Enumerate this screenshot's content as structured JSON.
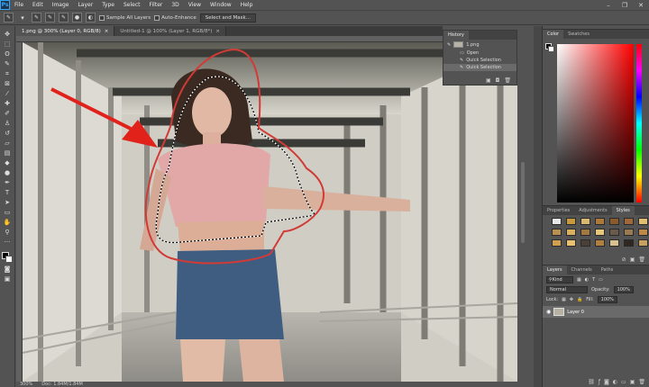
{
  "app": {
    "logo": "Ps"
  },
  "menu": [
    "File",
    "Edit",
    "Image",
    "Layer",
    "Type",
    "Select",
    "Filter",
    "3D",
    "View",
    "Window",
    "Help"
  ],
  "window_controls": [
    "–",
    "❐",
    "✕"
  ],
  "options": {
    "sample_all_layers": "Sample All Layers",
    "auto_enhance": "Auto-Enhance",
    "select_mask": "Select and Mask..."
  },
  "tabs": [
    {
      "label": "1.png @ 300% (Layer 0, RGB/8)",
      "close": "×"
    },
    {
      "label": "Untitled-1 @ 100% (Layer 1, RGB/8*)",
      "close": "×"
    }
  ],
  "status": {
    "zoom": "300%",
    "doc": "Doc: 1.84M/1.84M"
  },
  "history": {
    "title": "History",
    "snapshot": "1.png",
    "items": [
      "Open",
      "Quick Selection",
      "Quick Selection"
    ]
  },
  "color_panel": {
    "tabs": [
      "Color",
      "Swatches"
    ]
  },
  "styles_panel": {
    "tabs": [
      "Properties",
      "Adjustments",
      "Styles"
    ],
    "swatch_colors": [
      "#e8e8e8",
      "#c89a3c",
      "#d9b870",
      "#b07838",
      "#8a5a2a",
      "#a06838",
      "#e0c070",
      "#b89050",
      "#d8b060",
      "#a07840",
      "#e6c878",
      "#6a5a4a",
      "#9a7a50",
      "#c08848",
      "#d0a050",
      "#e8c070",
      "#4a4038",
      "#b08040",
      "#d8c090",
      "#302820",
      "#c8a060"
    ]
  },
  "layers_panel": {
    "tabs": [
      "Layers",
      "Channels",
      "Paths"
    ],
    "kind": "Kind",
    "blend": "Normal",
    "opacity_label": "Opacity:",
    "opacity": "100%",
    "lock_label": "Lock:",
    "fill_label": "Fill:",
    "fill": "100%",
    "layer_name": "Layer 0"
  }
}
